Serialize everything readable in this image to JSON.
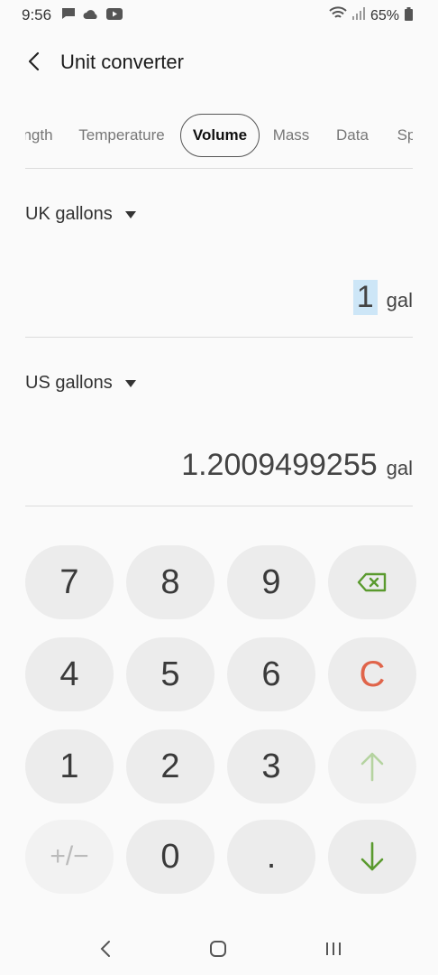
{
  "status_bar": {
    "time": "9:56",
    "battery": "65%",
    "icons_left": [
      "message-icon",
      "cloud-icon",
      "youtube-icon"
    ],
    "icons_right": [
      "wifi-icon",
      "signal-icon",
      "battery-icon"
    ]
  },
  "header": {
    "title": "Unit converter"
  },
  "tabs": [
    {
      "label": "ngth"
    },
    {
      "label": "Temperature"
    },
    {
      "label": "Volume",
      "active": true
    },
    {
      "label": "Mass"
    },
    {
      "label": "Data"
    },
    {
      "label": "Sp"
    }
  ],
  "from": {
    "unit_name": "UK gallons",
    "value": "1",
    "unit_abbr": "gal"
  },
  "to": {
    "unit_name": "US gallons",
    "value": "1.2009499255",
    "unit_abbr": "gal"
  },
  "keypad": {
    "k7": "7",
    "k8": "8",
    "k9": "9",
    "k4": "4",
    "k5": "5",
    "k6": "6",
    "k1": "1",
    "k2": "2",
    "k3": "3",
    "plusminus": "+/−",
    "k0": "0",
    "dot": ".",
    "clear": "C"
  },
  "colors": {
    "accent_green": "#5a9a2e",
    "clear_red": "#e0644a",
    "highlight": "#cde6f7"
  }
}
